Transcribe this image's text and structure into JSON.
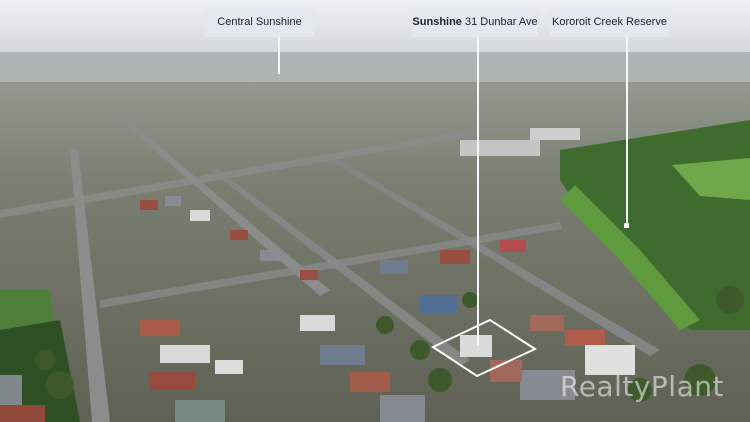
{
  "callouts": {
    "central_sunshine": {
      "label": "Central Sunshine"
    },
    "property": {
      "suburb": "Sunshine",
      "address": "31 Dunbar Ave"
    },
    "kororoit_creek": {
      "label": "Kororoit Creek Reserve"
    }
  },
  "watermark": {
    "text": "RealtyPlant"
  },
  "colors": {
    "sky_top": "#e9edf1",
    "haze": "#c7cdd2",
    "suburb": "#6f7266",
    "road": "#7d7f80",
    "park": "#4f8c3a",
    "roof_red": "#9b4a3c",
    "roof_grey": "#8a8f97",
    "roof_white": "#e4e6e6",
    "boundary": "#ffffff"
  }
}
